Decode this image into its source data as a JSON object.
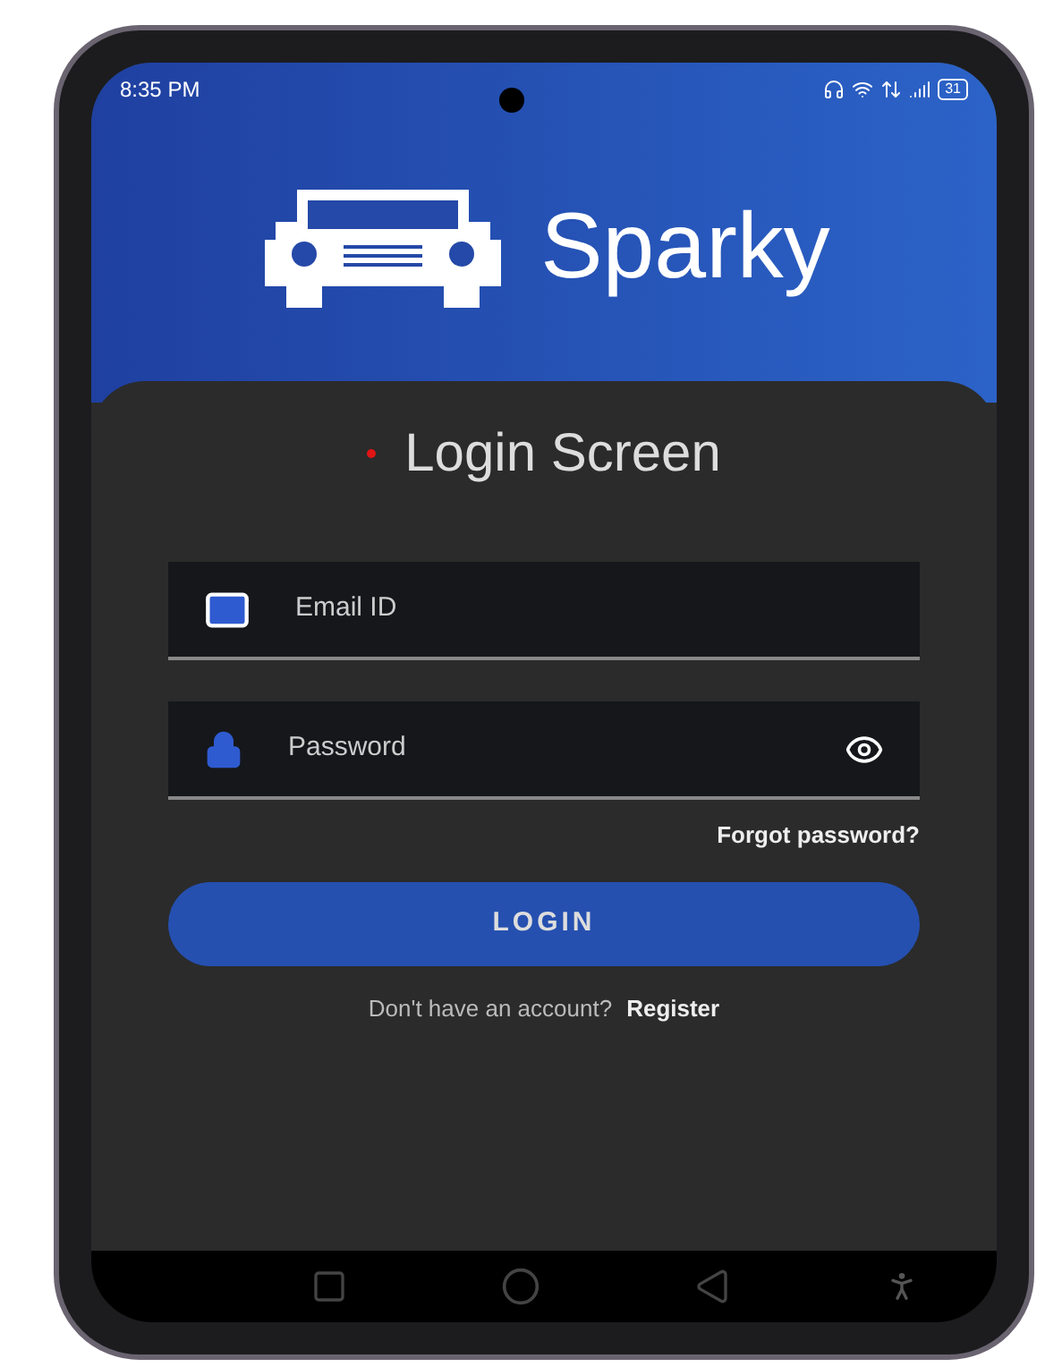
{
  "status_bar": {
    "time": "8:35 PM",
    "battery": "31"
  },
  "app": {
    "name": "Sparky"
  },
  "login": {
    "title": "Login Screen",
    "fields": [
      {
        "kind": "email",
        "placeholder": "Email ID"
      },
      {
        "kind": "password",
        "placeholder": "Password"
      }
    ],
    "forgot_link": "Forgot password?",
    "button": "LOGIN",
    "register_prompt": "Don't have an account?",
    "register_link": "Register"
  }
}
